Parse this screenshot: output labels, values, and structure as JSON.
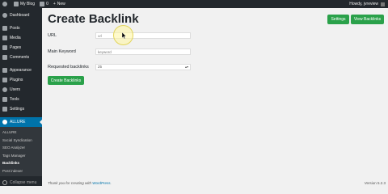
{
  "adminbar": {
    "site_name": "My Blog",
    "comments_count": "0",
    "new_label": "New",
    "howdy": "Howdy, jvreview"
  },
  "sidebar": {
    "items": [
      {
        "label": "Dashboard",
        "icon": "dashboard-icon"
      },
      {
        "label": "Posts",
        "icon": "pin-icon"
      },
      {
        "label": "Media",
        "icon": "media-icon"
      },
      {
        "label": "Pages",
        "icon": "pages-icon"
      },
      {
        "label": "Comments",
        "icon": "comments-icon"
      },
      {
        "label": "Appearance",
        "icon": "brush-icon"
      },
      {
        "label": "Plugins",
        "icon": "plugin-icon"
      },
      {
        "label": "Users",
        "icon": "users-icon"
      },
      {
        "label": "Tools",
        "icon": "wrench-icon"
      },
      {
        "label": "Settings",
        "icon": "settings-icon"
      },
      {
        "label": "ALLURE",
        "icon": "allure-icon"
      }
    ],
    "submenu": [
      "ALLURE",
      "Social Syndication",
      "SEO Analyzer",
      "Tags Manager",
      "Backlinks",
      "Post indexer"
    ],
    "collapse_label": "Collapse menu"
  },
  "page": {
    "title": "Create Backlink",
    "settings_button": "Settings",
    "view_backlinks_button": "View Backlinks",
    "url_label": "URL",
    "url_value": "url",
    "keyword_label": "Main Keyword",
    "keyword_placeholder": "keyword",
    "requested_label": "Requested backlinks",
    "requested_value": "25",
    "create_button": "Create Backlinks"
  },
  "footer": {
    "thanks_prefix": "Thank you for creating with ",
    "wordpress_link": "WordPress",
    "thanks_suffix": ".",
    "version": "Version 5.2.3"
  },
  "colors": {
    "accent_green": "#2aa14a",
    "admin_dark": "#23282d",
    "active_blue": "#0073aa"
  }
}
